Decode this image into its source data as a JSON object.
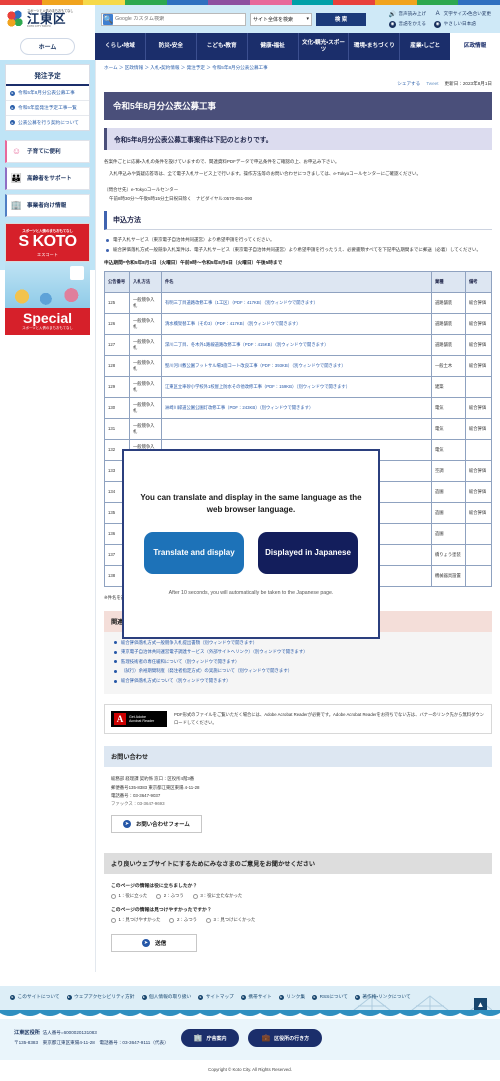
{
  "colors": {
    "brand_navy": "#1b2e6b",
    "header_blue": "#cfe9f7",
    "title_bar": "#4a4f7a",
    "accent_link": "#2557a7",
    "modal_blue": "#1d72b8",
    "modal_navy": "#131e5c",
    "strip": [
      "#e8413c",
      "#f0a31e",
      "#f6d94a",
      "#2ea84f",
      "#2f6fbf",
      "#8e4fa0",
      "#e8699b",
      "#00a0a8"
    ]
  },
  "header": {
    "logo_tagline": "スポーツと人情のまちおもてなし",
    "logo_city": "江東区",
    "logo_sub": "KOTO CITY TOKYO",
    "search_placeholder": "Google カスタム検索",
    "search_scope": "サイト全体を検索",
    "search_button": "検 索",
    "google_icon": "search-icon",
    "utilities": [
      {
        "icon": "speaker-icon",
        "label": "音声読み上げ"
      },
      {
        "icon": "globe-icon",
        "label": "言語をかえる"
      },
      {
        "icon": "font-size-icon",
        "label": "文字サイズ・色合い変更"
      },
      {
        "icon": "easy-japanese-icon",
        "label": "やさしい日本語"
      }
    ]
  },
  "gnav": {
    "home_label": "ホーム",
    "items": [
      {
        "label": "くらし・地域",
        "active": false
      },
      {
        "label": "防災・安全",
        "active": false
      },
      {
        "label": "こども・教育",
        "active": false
      },
      {
        "label": "健康・福祉",
        "active": false
      },
      {
        "label": "文化・観光・スポーツ",
        "active": false
      },
      {
        "label": "環境・まちづくり",
        "active": false
      },
      {
        "label": "産業・しごと",
        "active": false
      },
      {
        "label": "区政情報",
        "active": true
      }
    ]
  },
  "sidebar": {
    "heading": "発注予定",
    "links": [
      "令和5年8月分公表公募工事",
      "令和5年度発注予定工事一覧",
      "公表公募を行う契約について"
    ],
    "shortcuts": [
      {
        "label": "子育てに便利",
        "icon": "children-icon"
      },
      {
        "label": "高齢者をサポート",
        "icon": "elderly-icon"
      },
      {
        "label": "事業者向け情報",
        "icon": "business-icon"
      }
    ],
    "banner": {
      "tagline": "スポーツと人情のまちおもてなし",
      "title": "S KOTO",
      "subtitle": "エスコート",
      "special_big": "Special",
      "special_small": "スポーツと人情のまちおもてなし"
    }
  },
  "breadcrumb": "ホーム ＞ 区政情報 ＞ 入札・契約情報 ＞ 発注予定 ＞ 令和5年8月分公表公募工事",
  "share": {
    "label": "シェアする",
    "tweet": "Tweet",
    "updated": "更新日：2023年8月1日"
  },
  "main": {
    "title": "令和5年8月分公表公募工事",
    "lead": "令和5年8月分公表公募工事案件は下記のとおりです。",
    "paragraphs": [
      "各案件ごとに応募・入札の条件を設けていますので、関連資料PDFデータで申込条件をご確認の上、お申込み下さい。",
      "入札申込みや質疑応答等は、全て電子入札サービス上で行います。操作方法等のお問い合わせにつきましては、e-Tokyoコールセンターにご確認ください。"
    ],
    "contact_center": "（問合せ先）e-Tokyoコールセンター",
    "contact_hours": "午前8時30分～午後5時15分土日祝日除く　ナビダイヤル:0570-051-090",
    "method_heading": "申込方法",
    "method_bullets": [
      "電子入札サービス（東京電子自治体共同運営）より希望申請を行ってください。",
      "総合評価落札方式一般競争入札案件は、電子入札サービス（東京電子自治体共同運営）より希望申請を行ったうえ、必要書類すべてを下記申込期間までに郵送（必着）してください。"
    ],
    "deadline": "申込期間=令和5年8月1日（火曜日）午前9時～令和5年8月8日（火曜日）午後5時まで"
  },
  "table": {
    "headers": [
      "公告番号",
      "入札方法",
      "件名",
      "業種",
      "備考"
    ],
    "rows": [
      {
        "no": "125",
        "method": "一般競争入札",
        "subject": "有明三丁目道路改修工事（1工区）（PDF：417KB）（別ウィンドウで開きます）",
        "kind": "道路舗装",
        "note": "総合評価"
      },
      {
        "no": "126",
        "method": "一般競争入札",
        "subject": "清水橋架替工事（その3）（PDF：417KB）（別ウィンドウで開きます）",
        "kind": "道路舗装",
        "note": "総合評価"
      },
      {
        "no": "127",
        "method": "一般競争入札",
        "subject": "深川二丁目、冬木外1路線道路改修工事（PDF：415KB）（別ウィンドウで開きます）",
        "kind": "道路舗装",
        "note": "総合評価"
      },
      {
        "no": "128",
        "method": "一般競争入札",
        "subject": "堅川河川敷公園フットサル場3面コート改良工事（PDF：393KB）（別ウィンドウで開きます）",
        "kind": "一般土木",
        "note": "総合評価"
      },
      {
        "no": "129",
        "method": "一般競争入札",
        "subject": "江東区立車砂小学校外1校屋上防水その他改修工事（PDF：159KB）（別ウィンドウで開きます）",
        "kind": "建築",
        "note": ""
      },
      {
        "no": "130",
        "method": "一般競争入札",
        "subject": "洲崎川緑道公園公園灯改修工事（PDF：243KB）（別ウィンドウで開きます）",
        "kind": "電気",
        "note": "総合評価"
      },
      {
        "no": "131",
        "method": "一般競争入札",
        "subject": "",
        "kind": "電気",
        "note": "総合評価"
      },
      {
        "no": "132",
        "method": "一般競争入札",
        "subject": "",
        "kind": "電気",
        "note": ""
      },
      {
        "no": "133",
        "method": "一般競争入札",
        "subject": "",
        "kind": "空調",
        "note": "総合評価"
      },
      {
        "no": "134",
        "method": "一般競争入札",
        "subject": "",
        "kind": "造園",
        "note": "総合評価"
      },
      {
        "no": "135",
        "method": "一般競争入札",
        "subject": "",
        "kind": "造園",
        "note": "総合評価"
      },
      {
        "no": "136",
        "method": "一般競争入札",
        "subject": "",
        "kind": "造園",
        "note": ""
      },
      {
        "no": "137",
        "method": "一般競争入札",
        "subject": "",
        "kind": "橋りょう塗装",
        "note": ""
      },
      {
        "no": "138",
        "method": "一般競争入札",
        "subject": "",
        "kind": "機械器具設置",
        "note": ""
      }
    ],
    "footnote": "※件名を選択すると公告内容がPDFファイルで表示されます"
  },
  "related": {
    "heading": "関連リンク",
    "links": [
      "総合評価落札方式一般競争入札提出書類（別ウィンドウで開きます）",
      "東京電子自治体共同運営電子調達サービス（外部サイトへリンク）（別ウィンドウで開きます）",
      "監理技術者の専任緩和について（別ウィンドウで開きます）",
      "（試行）余裕期間制度（発注者指定方式）の実施について（別ウィンドウで開きます）",
      "総合評価落札方式について（別ウィンドウで開きます）"
    ]
  },
  "adobe": {
    "badge_get": "Get Adobe",
    "badge_name": "Acrobat Reader",
    "description": "PDF形式のファイルをご覧いただく場合には、Adobe Acrobat Readerが必要です。Adobe Acrobat Readerをお持ちでない方は、バナーのリンク先から無料ダウンロードしてください。"
  },
  "contact": {
    "heading": "お問い合わせ",
    "lines": [
      "総務部 経理課 契約係 窓口：区役所4階3番",
      "郵便番号135-8383 東京都江東区東陽 4-11-28",
      "電話番号：03-3647-9037",
      "ファックス：03-3647-9693"
    ],
    "button": "お問い合わせフォーム"
  },
  "survey": {
    "heading": "より良いウェブサイトにするためにみなさまのご意見をお聞かせください",
    "q1": "このページの情報は役に立ちましたか？",
    "q1_options": [
      "1：役に立った",
      "2：ふつう",
      "3：役に立たなかった"
    ],
    "q2": "このページの情報は見つけやすかったですか？",
    "q2_options": [
      "1：見つけやすかった",
      "2：ふつう",
      "3：見つけにくかった"
    ],
    "submit": "送信"
  },
  "modal": {
    "message": "You can translate and display in the same language as the web browser language.",
    "translate_button": "Translate and display",
    "japanese_button": "Displayed in Japanese",
    "note": "After 10 seconds, you will automatically be taken to the Japanese page."
  },
  "footer": {
    "links": [
      "このサイトについて",
      "ウェブアクセシビリティ方針",
      "個人情報の取り扱い",
      "サイトマップ",
      "携帯サイト",
      "リンク集",
      "RSSについて",
      "著作権・リンクについて"
    ],
    "to_top": "▲",
    "office_name": "江東区役所",
    "corporate_number": "法人番号=6000020131083",
    "address": "〒135-8383　東京都江東区東陽4-11-28　電話番号：03-3647-9111（代表）",
    "buttons": [
      {
        "label": "庁舎案内",
        "icon": "building-icon"
      },
      {
        "label": "区役所の行き方",
        "icon": "bag-icon"
      }
    ],
    "copyright": "Copyright © Koto City. All Rights Reserved."
  }
}
